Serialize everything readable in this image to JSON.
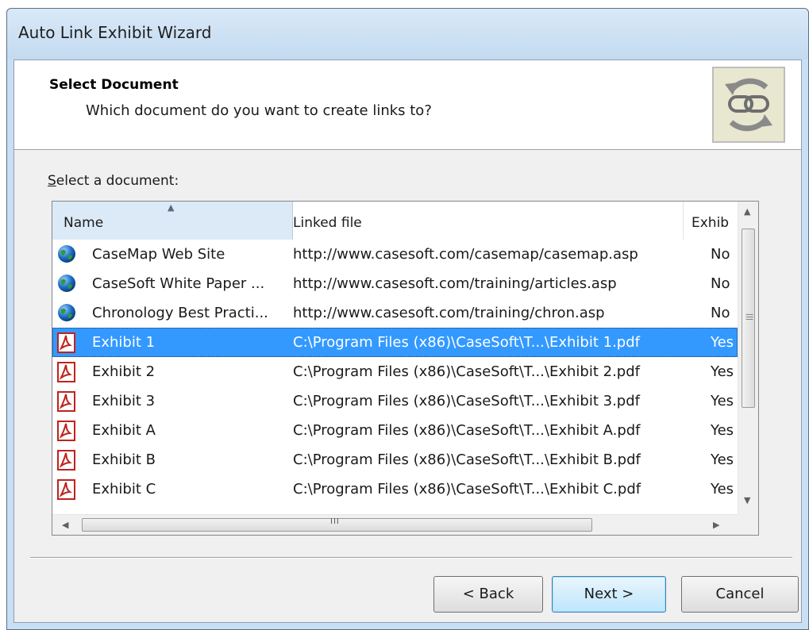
{
  "window": {
    "title": "Auto Link Exhibit Wizard"
  },
  "header": {
    "title": "Select Document",
    "subtitle": "Which document do you want to create links to?",
    "icon": "chain-link-refresh-icon"
  },
  "list": {
    "label": "Select a document:",
    "columns": [
      {
        "label": "Name",
        "sorted": "ascending"
      },
      {
        "label": "Linked file"
      },
      {
        "label": "Exhib"
      }
    ],
    "rows": [
      {
        "icon": "globe-icon",
        "name": "CaseMap Web Site",
        "file": "http://www.casesoft.com/casemap/casemap.asp",
        "exhibit": "No",
        "selected": false
      },
      {
        "icon": "globe-icon",
        "name": "CaseSoft White Paper ...",
        "file": "http://www.casesoft.com/training/articles.asp",
        "exhibit": "No",
        "selected": false
      },
      {
        "icon": "globe-icon",
        "name": "Chronology Best Practi...",
        "file": "http://www.casesoft.com/training/chron.asp",
        "exhibit": "No",
        "selected": false
      },
      {
        "icon": "pdf-icon",
        "name": "Exhibit 1",
        "file": "C:\\Program Files (x86)\\CaseSoft\\T...\\Exhibit 1.pdf",
        "exhibit": "Yes",
        "selected": true
      },
      {
        "icon": "pdf-icon",
        "name": "Exhibit 2",
        "file": "C:\\Program Files (x86)\\CaseSoft\\T...\\Exhibit 2.pdf",
        "exhibit": "Yes",
        "selected": false
      },
      {
        "icon": "pdf-icon",
        "name": "Exhibit 3",
        "file": "C:\\Program Files (x86)\\CaseSoft\\T...\\Exhibit 3.pdf",
        "exhibit": "Yes",
        "selected": false
      },
      {
        "icon": "pdf-icon",
        "name": "Exhibit A",
        "file": "C:\\Program Files (x86)\\CaseSoft\\T...\\Exhibit A.pdf",
        "exhibit": "Yes",
        "selected": false
      },
      {
        "icon": "pdf-icon",
        "name": "Exhibit B",
        "file": "C:\\Program Files (x86)\\CaseSoft\\T...\\Exhibit B.pdf",
        "exhibit": "Yes",
        "selected": false
      },
      {
        "icon": "pdf-icon",
        "name": "Exhibit C",
        "file": "C:\\Program Files (x86)\\CaseSoft\\T...\\Exhibit C.pdf",
        "exhibit": "Yes",
        "selected": false
      }
    ]
  },
  "buttons": {
    "back": "< Back",
    "next": "Next >",
    "cancel": "Cancel"
  },
  "colors": {
    "selection": "#3399ff",
    "title_bar": "#c9dff3",
    "pdf_red": "#c0221b",
    "globe_blue": "#1f6fc7",
    "globe_green": "#2f9a3a"
  }
}
